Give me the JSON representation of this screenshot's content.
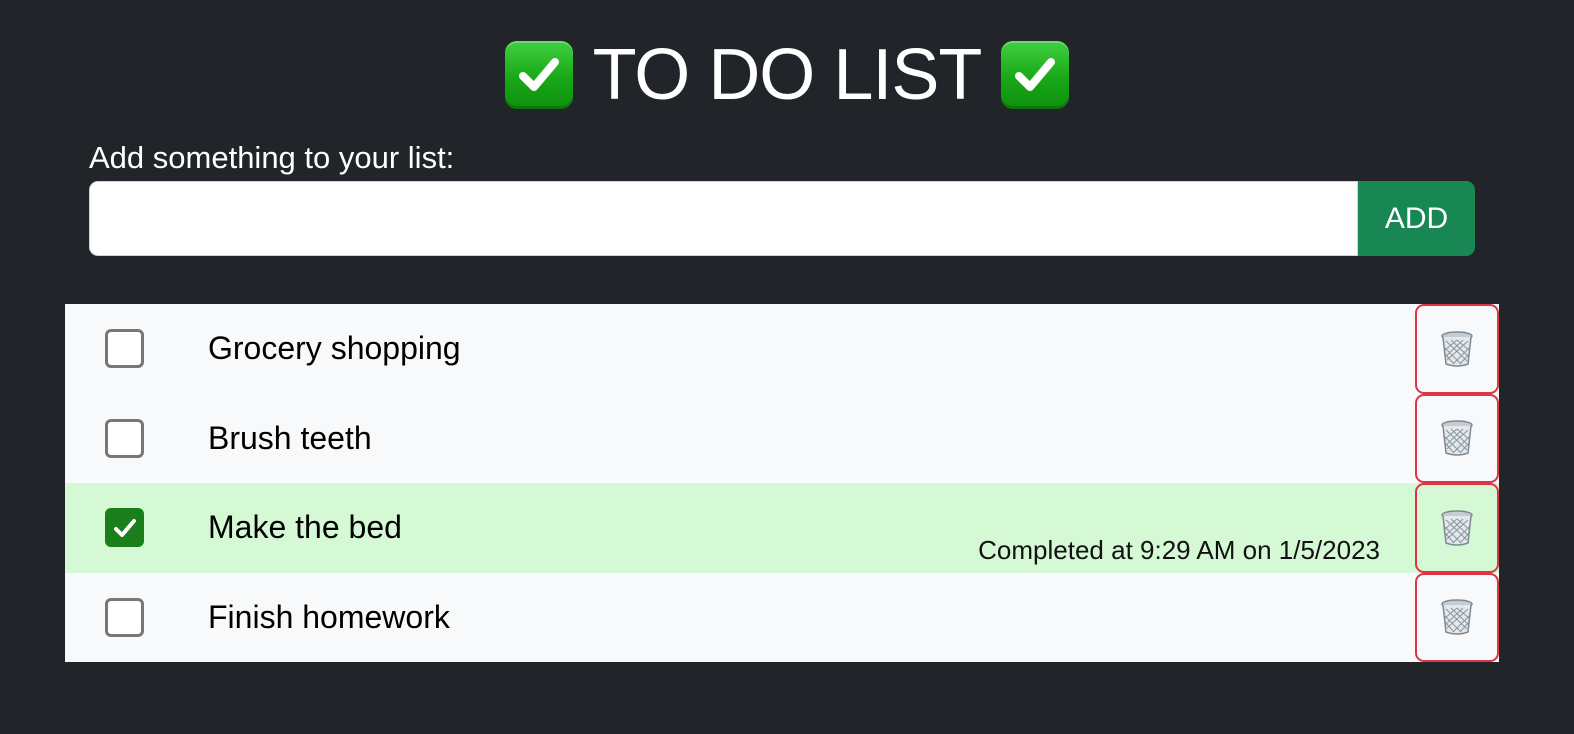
{
  "header": {
    "title": "TO DO LIST",
    "title_icon": "check-mark-button-emoji",
    "accent_color": "#16a816"
  },
  "form": {
    "label": "Add something to your list:",
    "input_value": "",
    "input_placeholder": "",
    "add_label": "ADD",
    "add_color": "#198754"
  },
  "todos": [
    {
      "label": "Grocery shopping",
      "checked": false,
      "completed_text": ""
    },
    {
      "label": "Brush teeth",
      "checked": false,
      "completed_text": ""
    },
    {
      "label": "Make the bed",
      "checked": true,
      "completed_text": "Completed at 9:29 AM on 1/5/2023"
    },
    {
      "label": "Finish homework",
      "checked": false,
      "completed_text": ""
    }
  ],
  "colors": {
    "background": "#212529",
    "completed_row": "#d5f9d5",
    "delete_border": "#dc3545"
  },
  "icons": {
    "delete": "wastebasket-icon",
    "checkbox_checked": "check-icon"
  }
}
